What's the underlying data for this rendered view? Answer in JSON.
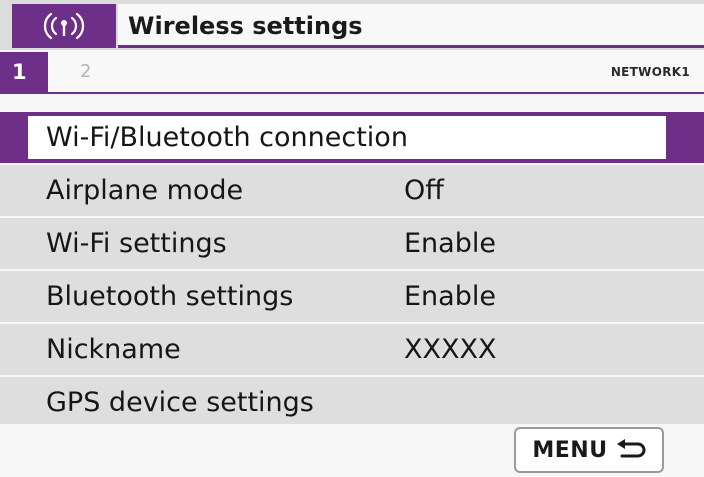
{
  "header": {
    "icon": "wireless-signal-icon",
    "title": "Wireless settings"
  },
  "tabs": {
    "active": "1",
    "inactive": "2",
    "name": "NETWORK1"
  },
  "menu": {
    "items": [
      {
        "label": "Wi-Fi/Bluetooth connection",
        "value": ""
      },
      {
        "label": "Airplane mode",
        "value": "Off"
      },
      {
        "label": "Wi-Fi settings",
        "value": "Enable"
      },
      {
        "label": "Bluetooth settings",
        "value": "Enable"
      },
      {
        "label": "Nickname",
        "value": "XXXXX"
      },
      {
        "label": "GPS device settings",
        "value": ""
      }
    ]
  },
  "footer": {
    "menu_button_label": "MENU",
    "back_icon": "return-arrow-icon"
  },
  "colors": {
    "accent": "#6e2f88",
    "row_background": "#dedede",
    "background": "#f6f6f6"
  }
}
